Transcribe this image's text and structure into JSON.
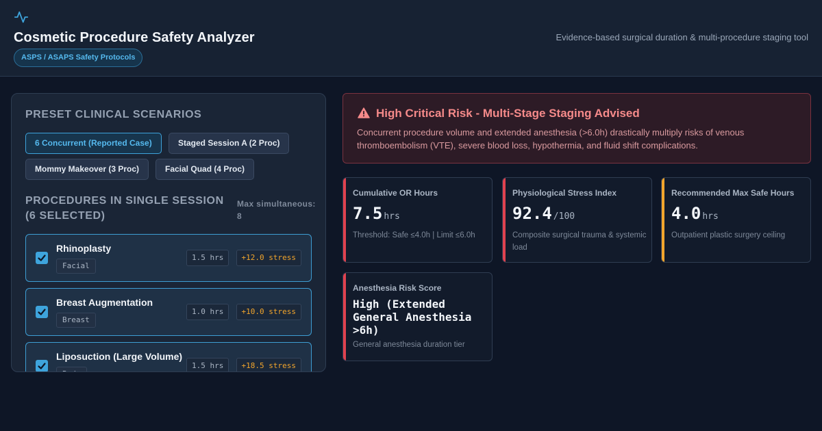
{
  "header": {
    "title": "Cosmetic Procedure Safety Analyzer",
    "protocol_badge": "ASPS / ASAPS Safety Protocols",
    "subtitle": "Evidence-based surgical duration & multi-procedure staging tool"
  },
  "presets": {
    "title": "Preset Clinical Scenarios",
    "buttons": [
      {
        "label": "6 Concurrent (Reported Case)",
        "active": true
      },
      {
        "label": "Staged Session A (2 Proc)",
        "active": false
      },
      {
        "label": "Mommy Makeover (3 Proc)",
        "active": false
      },
      {
        "label": "Facial Quad (4 Proc)",
        "active": false
      }
    ]
  },
  "procedures": {
    "title": "Procedures in Single Session (6 Selected)",
    "max_label": "Max simultaneous: 8",
    "items": [
      {
        "name": "Rhinoplasty",
        "category": "Facial",
        "hours": "1.5 hrs",
        "stress": "+12.0 stress",
        "checked": true
      },
      {
        "name": "Breast Augmentation",
        "category": "Breast",
        "hours": "1.0 hrs",
        "stress": "+10.0 stress",
        "checked": true
      },
      {
        "name": "Liposuction (Large Volume)",
        "category": "Body",
        "hours": "1.5 hrs",
        "stress": "+18.5 stress",
        "checked": true
      }
    ]
  },
  "alert": {
    "title": "High Critical Risk - Multi-Stage Staging Advised",
    "body": "Concurrent procedure volume and extended anesthesia (>6.0h) drastically multiply risks of venous thromboembolism (VTE), severe blood loss, hypothermia, and fluid shift complications."
  },
  "metrics": [
    {
      "label": "Cumulative OR Hours",
      "value": "7.5",
      "unit": "hrs",
      "note": "Threshold: Safe ≤4.0h | Limit ≤6.0h",
      "accent": "#e0424f"
    },
    {
      "label": "Physiological Stress Index",
      "value": "92.4",
      "unit": "/100",
      "note": "Composite surgical trauma & systemic load",
      "accent": "#e0424f"
    },
    {
      "label": "Recommended Max Safe Hours",
      "value": "4.0",
      "unit": "hrs",
      "note": "Outpatient plastic surgery ceiling",
      "accent": "#f2a52c"
    },
    {
      "label": "Anesthesia Risk Score",
      "value": "High (Extended General Anesthesia >6h)",
      "unit": "",
      "note": "General anesthesia duration tier",
      "accent": "#e0424f"
    }
  ],
  "colors": {
    "accent_blue": "#3ea4dc",
    "danger": "#e0424f",
    "warning": "#f2a52c",
    "background": "#0e1626"
  }
}
